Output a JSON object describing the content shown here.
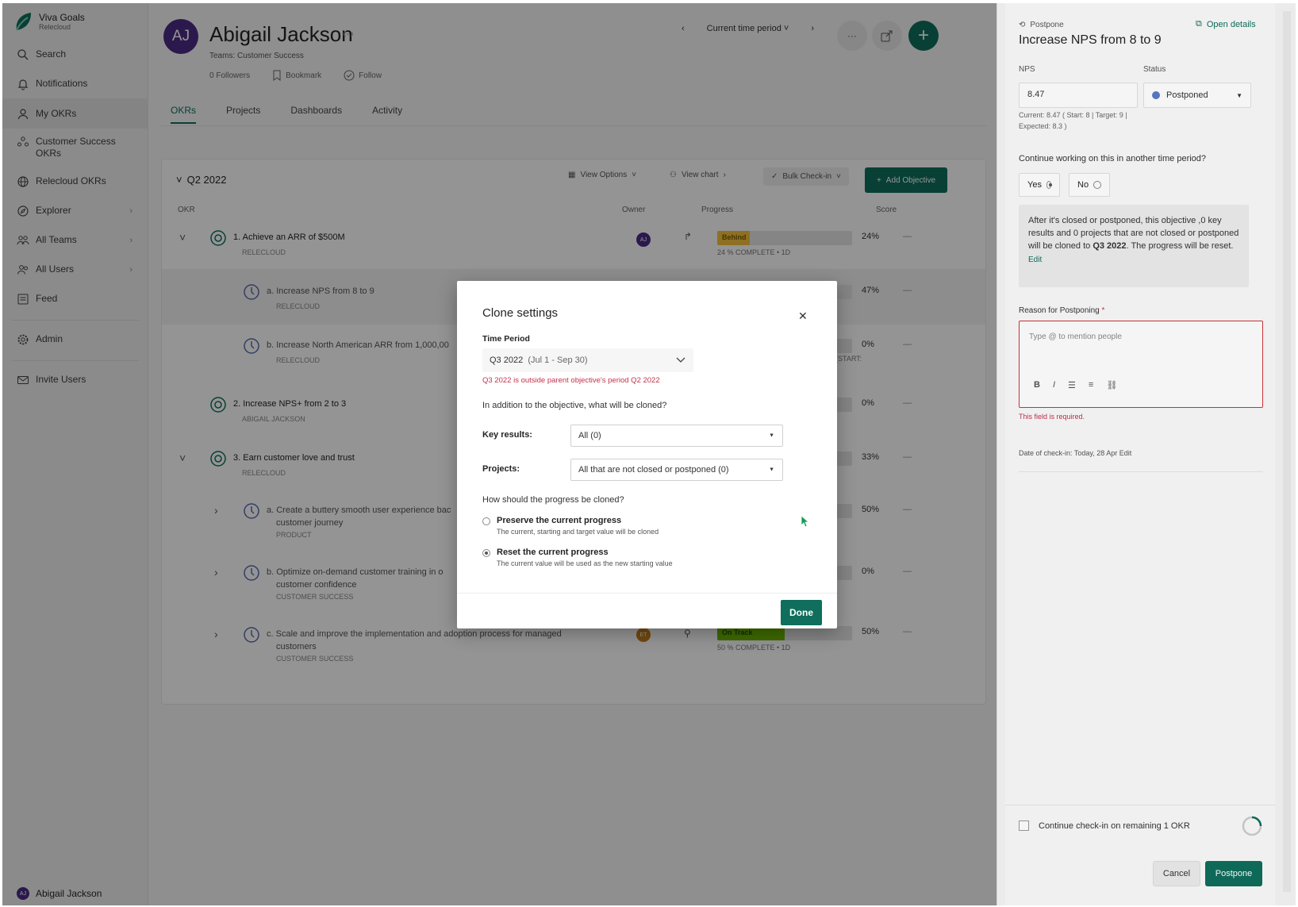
{
  "sidebar": {
    "brand_name": "Viva Goals",
    "brand_org": "Relecloud",
    "items": [
      {
        "label": "Search",
        "icon": "search-icon"
      },
      {
        "label": "Notifications",
        "icon": "bell-icon"
      },
      {
        "label": "My OKRs",
        "icon": "person-icon"
      },
      {
        "label": "Customer Success OKRs",
        "icon": "team-icon"
      },
      {
        "label": "Relecloud OKRs",
        "icon": "globe-icon"
      },
      {
        "label": "Explorer",
        "icon": "compass-icon"
      },
      {
        "label": "All Teams",
        "icon": "teams-icon"
      },
      {
        "label": "All Users",
        "icon": "users-icon"
      },
      {
        "label": "Feed",
        "icon": "feed-icon"
      },
      {
        "label": "Admin",
        "icon": "gear-icon"
      },
      {
        "label": "Invite Users",
        "icon": "mail-icon"
      }
    ],
    "user_name": "Abigail Jackson",
    "user_initials": "AJ"
  },
  "header": {
    "initials": "AJ",
    "name": "Abigail Jackson",
    "teams": "Teams: Customer Success",
    "followers": "0 Followers",
    "bookmark": "Bookmark",
    "follow": "Follow",
    "period": "Current time period"
  },
  "tabs": [
    "OKRs",
    "Projects",
    "Dashboards",
    "Activity"
  ],
  "okr_list": {
    "period_label": "Q2 2022",
    "view_options": "View Options",
    "view_chart": "View chart",
    "bulk_checkin": "Bulk Check-in",
    "add_objective": "Add Objective",
    "col_okr": "OKR",
    "col_owner": "Owner",
    "col_progress": "Progress",
    "col_score": "Score",
    "rows": [
      {
        "title": "1. Achieve an ARR of $500M",
        "sub": "RELECLOUD",
        "pct": "24%",
        "score": "—",
        "status": "Behind",
        "meta": "24 % COMPLETE • 1D"
      },
      {
        "title": "a. Increase NPS from 8 to 9",
        "sub": "RELECLOUD",
        "pct": "47%",
        "score": "—"
      },
      {
        "title": "b. Increase North American ARR from 1,000,00",
        "sub": "RELECLOUD",
        "pct": "0%",
        "score": "—",
        "meta": "ARR: 1M (START:"
      },
      {
        "title": "2. Increase NPS+ from 2 to 3",
        "sub": "ABIGAIL JACKSON",
        "pct": "0%",
        "score": "—"
      },
      {
        "title": "3. Earn customer love and trust",
        "sub": "RELECLOUD",
        "pct": "33%",
        "score": "—"
      },
      {
        "title": "a. Create a buttery smooth user experience bac",
        "title2": "customer journey",
        "sub": "PRODUCT",
        "pct": "50%",
        "score": "—"
      },
      {
        "title": "b. Optimize on-demand customer training in o",
        "title2": "customer confidence",
        "sub": "CUSTOMER SUCCESS",
        "pct": "0%",
        "score": "—"
      },
      {
        "title": "c. Scale and improve the implementation and adoption process for managed",
        "title2": "customers",
        "sub": "CUSTOMER SUCCESS",
        "pct": "50%",
        "score": "—",
        "status": "On Track",
        "meta": "50 % COMPLETE • 1D",
        "owner": "ET"
      }
    ]
  },
  "panel": {
    "postpone_label": "Postpone",
    "open_details": "Open details",
    "title": "Increase NPS from 8 to 9",
    "nps_label": "NPS",
    "nps_value": "8.47",
    "status_label": "Status",
    "status_value": "Postponed",
    "current_line": "Current: 8.47 ( Start: 8 | Target: 9 |",
    "expected_line": "Expected: 8.3 )",
    "continue_q": "Continue working on this in another time period?",
    "yes": "Yes",
    "no": "No",
    "info_pre": "After it's closed or postponed, this objective ,0 key results and 0 projects that are not closed or postponed will be cloned to ",
    "info_bold": "Q3 2022",
    "info_post": ". The progress will be reset.",
    "edit": "Edit",
    "reason_label": "Reason for Postponing",
    "reason_required": "*",
    "reason_placeholder": "Type @ to mention people",
    "required_msg": "This field is required.",
    "checkin_date": "Date of check-in: Today, 28 Apr",
    "checkin_edit": "Edit",
    "continue_checkin": "Continue check-in on remaining 1 OKR",
    "cancel": "Cancel",
    "postpone_btn": "Postpone"
  },
  "modal": {
    "title": "Clone settings",
    "time_period_label": "Time Period",
    "time_period_value": "Q3 2022",
    "time_period_range": "(Jul 1 - Sep 30)",
    "time_period_error": "Q3 2022 is outside parent objective's period Q2 2022",
    "what_cloned": "In addition to the objective, what will be cloned?",
    "key_results_label": "Key results:",
    "key_results_value": "All (0)",
    "projects_label": "Projects:",
    "projects_value": "All that are not closed or postponed (0)",
    "progress_q": "How should the progress be cloned?",
    "opt1_title": "Preserve the current progress",
    "opt1_sub": "The current, starting and target value will be cloned",
    "opt2_title": "Reset the current progress",
    "opt2_sub": "The current value will be used as the new starting value",
    "selected_option": "Reset the current progress",
    "done": "Done"
  },
  "colors": {
    "accent": "#0f6e5c",
    "error": "#c4314b",
    "avatar": "#4b2c86",
    "behind": "#f3c13a",
    "on_track": "#6bb700"
  }
}
